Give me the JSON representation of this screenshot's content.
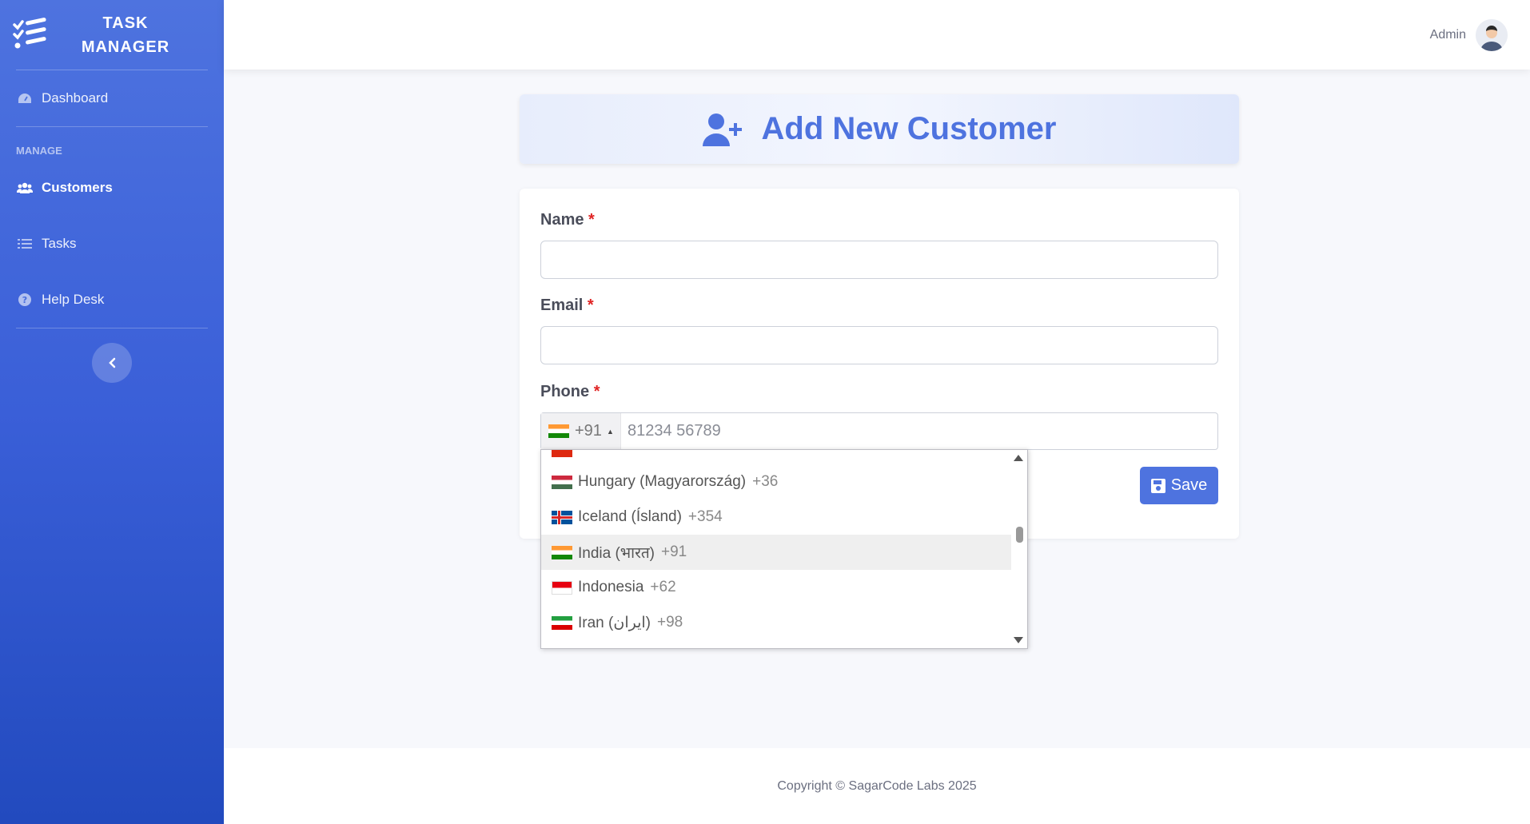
{
  "brand": {
    "line1": "TASK",
    "line2": "MANAGER"
  },
  "sidebar": {
    "dashboard": "Dashboard",
    "section": "MANAGE",
    "items": [
      {
        "label": "Customers",
        "icon": "users-icon",
        "active": true
      },
      {
        "label": "Tasks",
        "icon": "list-icon",
        "active": false
      },
      {
        "label": "Help Desk",
        "icon": "question-circle-icon",
        "active": false
      }
    ]
  },
  "topbar": {
    "user": "Admin"
  },
  "page": {
    "title": "Add New Customer"
  },
  "form": {
    "name_label": "Name",
    "email_label": "Email",
    "phone_label": "Phone",
    "required_mark": "*",
    "phone_code": "+91",
    "phone_placeholder": "81234 56789",
    "save_label": "Save"
  },
  "country_dropdown": {
    "options": [
      {
        "name": "Hungary (Magyarország)",
        "code": "+36",
        "highlighted": false
      },
      {
        "name": "Iceland (Ísland)",
        "code": "+354",
        "highlighted": false
      },
      {
        "name": "India (भारत)",
        "code": "+91",
        "highlighted": true
      },
      {
        "name": "Indonesia",
        "code": "+62",
        "highlighted": false
      },
      {
        "name": "Iran (‫ایران‬‎)",
        "code": "+98",
        "highlighted": false
      }
    ]
  },
  "footer": {
    "text": "Copyright © SagarCode Labs 2025"
  },
  "colors": {
    "primary": "#4e73df",
    "required": "#e02424"
  }
}
